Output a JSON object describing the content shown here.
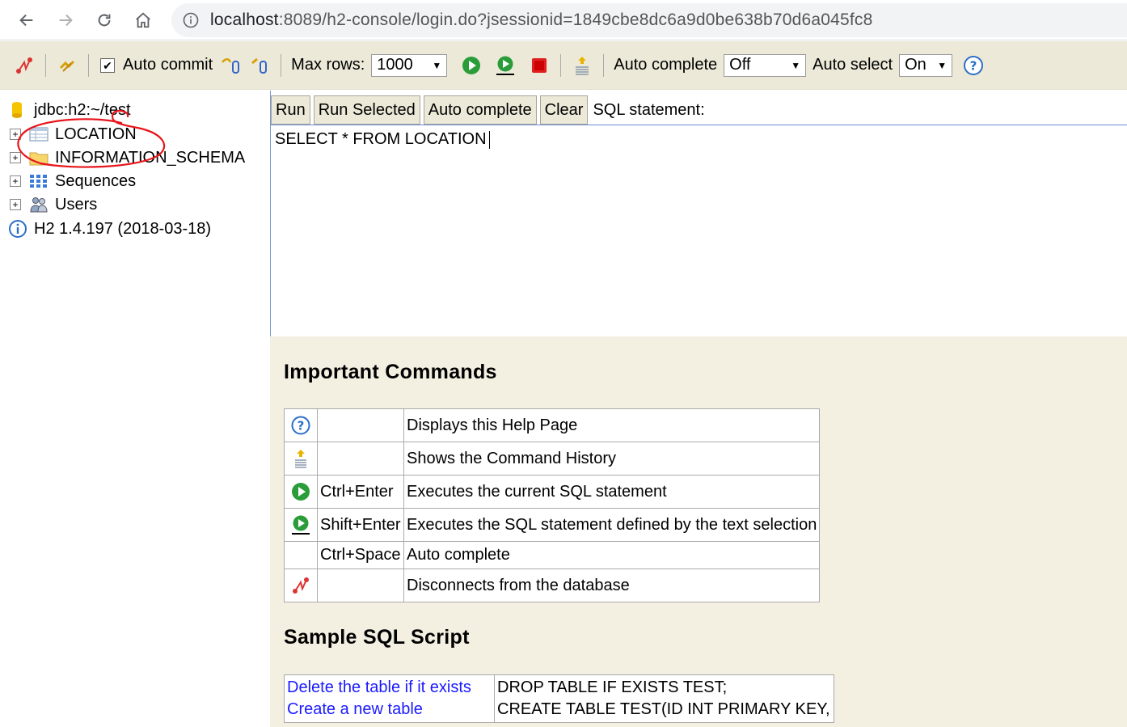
{
  "browser": {
    "url_host": "localhost",
    "url_rest": ":8089/h2-console/login.do?jsessionid=1849cbe8dc6a9d0be638b70d6a045fc8"
  },
  "toolbar": {
    "auto_commit_label": "Auto commit",
    "max_rows_label": "Max rows:",
    "max_rows_value": "1000",
    "auto_complete_label": "Auto complete",
    "auto_complete_value": "Off",
    "auto_select_label": "Auto select",
    "auto_select_value": "On"
  },
  "tree": {
    "connection": "jdbc:h2:~/test",
    "items": [
      {
        "label": "LOCATION",
        "icon": "table-icon"
      },
      {
        "label": "INFORMATION_SCHEMA",
        "icon": "folder-icon"
      },
      {
        "label": "Sequences",
        "icon": "sequences-icon"
      },
      {
        "label": "Users",
        "icon": "users-icon"
      }
    ],
    "version": "H2 1.4.197 (2018-03-18)"
  },
  "query": {
    "buttons": {
      "run": "Run",
      "run_selected": "Run Selected",
      "auto_complete": "Auto complete",
      "clear": "Clear"
    },
    "sql_label": "SQL statement:",
    "sql_text": "SELECT * FROM LOCATION"
  },
  "help": {
    "important_title": "Important Commands",
    "commands": [
      {
        "icon": "help-icon",
        "keys": "",
        "desc": "Displays this Help Page"
      },
      {
        "icon": "history-icon",
        "keys": "",
        "desc": "Shows the Command History"
      },
      {
        "icon": "run-icon",
        "keys": "Ctrl+Enter",
        "desc": "Executes the current SQL statement"
      },
      {
        "icon": "run-selected-icon",
        "keys": "Shift+Enter",
        "desc": "Executes the SQL statement defined by the text selection"
      },
      {
        "icon": "",
        "keys": "Ctrl+Space",
        "desc": "Auto complete"
      },
      {
        "icon": "disconnect-icon",
        "keys": "",
        "desc": "Disconnects from the database"
      }
    ],
    "sample_title": "Sample SQL Script",
    "sample_links": [
      "Delete the table if it exists",
      "Create a new table"
    ],
    "sample_sql": [
      "DROP TABLE IF EXISTS TEST;",
      "CREATE TABLE TEST(ID INT PRIMARY KEY,"
    ]
  },
  "colors": {
    "toolbar_bg": "#ece9d8",
    "help_bg": "#f3f0e2",
    "link": "#1a1aff",
    "annotation_red": "#e8141b"
  }
}
